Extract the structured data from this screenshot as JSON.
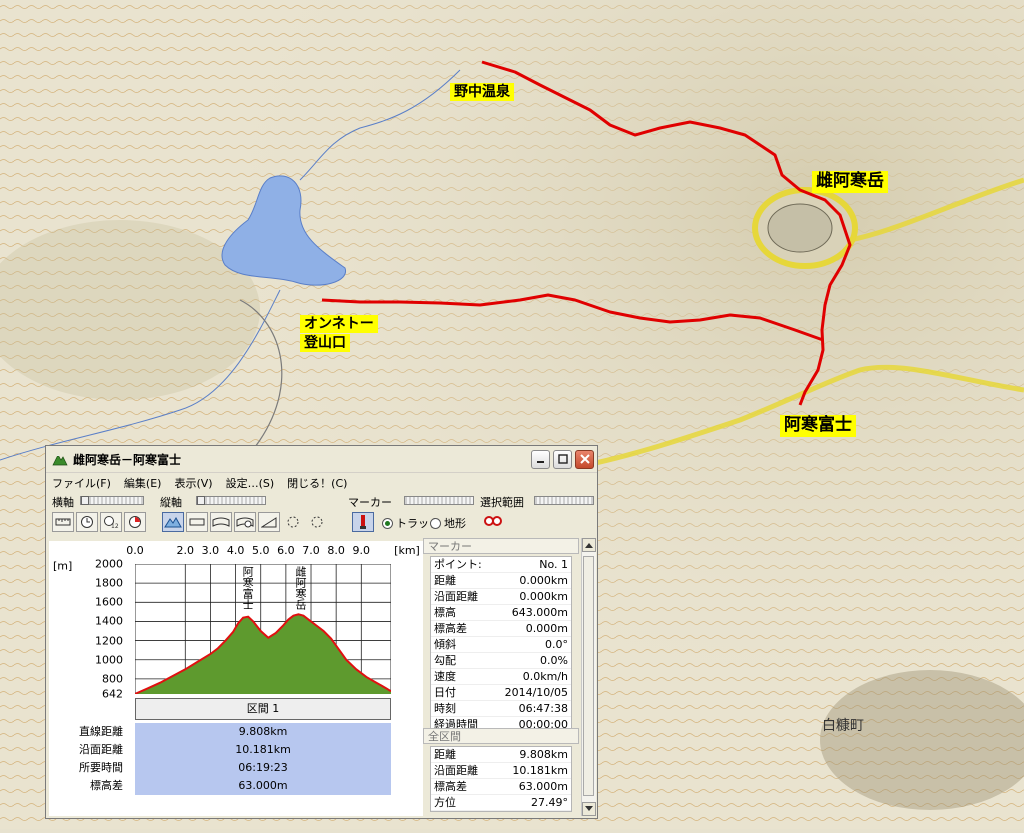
{
  "map": {
    "labels": [
      {
        "id": "nonaka",
        "text": "野中温泉"
      },
      {
        "id": "meakan",
        "text": "雌阿寒岳"
      },
      {
        "id": "onneto1",
        "text": "オンネトー"
      },
      {
        "id": "onneto2",
        "text": "登山口"
      },
      {
        "id": "fuji",
        "text": "阿寒富士"
      }
    ],
    "town_label": "白糠町",
    "colors": {
      "track": "#e00000",
      "label_bg": "#ffff00",
      "boundary": "#e6d73a",
      "lake": "#8fb0e6"
    }
  },
  "window": {
    "title": "雌阿寒岳－阿寒富士",
    "menu": [
      "ファイル(F)",
      "編集(E)",
      "表示(V)",
      "設定…(S)",
      "閉じる！(C)"
    ],
    "toolbar": {
      "horizontal_axis": "横軸",
      "vertical_axis": "縦軸",
      "marker": "マーカー",
      "selection_range": "選択範囲",
      "radio_track": "トラック",
      "radio_terrain": "地形",
      "selected_radio": "トラック"
    }
  },
  "chart_data": {
    "type": "area",
    "x_unit": "[km]",
    "y_unit": "[m]",
    "x_ticks": [
      "0.0",
      "2.0",
      "3.0",
      "4.0",
      "5.0",
      "6.0",
      "7.0",
      "8.0",
      "9.0"
    ],
    "y_ticks": [
      "2000",
      "1800",
      "1600",
      "1400",
      "1200",
      "1000",
      "800",
      "642"
    ],
    "xlim": [
      0,
      10.181
    ],
    "ylim": [
      642,
      2000
    ],
    "x": [
      0.0,
      0.5,
      1.0,
      1.5,
      2.0,
      2.5,
      3.0,
      3.3,
      3.6,
      3.9,
      4.1,
      4.3,
      4.5,
      4.7,
      5.0,
      5.3,
      5.6,
      5.9,
      6.1,
      6.3,
      6.5,
      6.7,
      6.9,
      7.2,
      7.5,
      7.8,
      8.1,
      8.4,
      8.8,
      9.2,
      9.6,
      10.0,
      10.181
    ],
    "y": [
      643,
      700,
      760,
      830,
      900,
      980,
      1060,
      1120,
      1200,
      1290,
      1380,
      1440,
      1450,
      1400,
      1300,
      1230,
      1280,
      1360,
      1420,
      1460,
      1475,
      1460,
      1420,
      1360,
      1300,
      1220,
      1110,
      1000,
      900,
      820,
      760,
      700,
      670
    ],
    "peak_labels": [
      {
        "text": "阿寒富士",
        "x": 4.4
      },
      {
        "text": "雌阿寒岳",
        "x": 6.5
      }
    ],
    "fill_color": "#5e9a2e",
    "line_color": "#e01010"
  },
  "section": {
    "label": "区間 1",
    "stats": [
      {
        "label": "直線距離",
        "value": "9.808km"
      },
      {
        "label": "沿面距離",
        "value": "10.181km"
      },
      {
        "label": "所要時間",
        "value": "06:19:23"
      },
      {
        "label": "標高差",
        "value": "63.000m"
      }
    ]
  },
  "marker_panel": {
    "title": "マーカー",
    "rows": [
      {
        "k": "ポイント:",
        "v": "No. 1"
      },
      {
        "k": "距離",
        "v": "0.000km"
      },
      {
        "k": "沿面距離",
        "v": "0.000km"
      },
      {
        "k": "標高",
        "v": "643.000m"
      },
      {
        "k": "標高差",
        "v": "0.000m"
      },
      {
        "k": "傾斜",
        "v": "0.0°"
      },
      {
        "k": "勾配",
        "v": "0.0%"
      },
      {
        "k": "速度",
        "v": "0.0km/h"
      },
      {
        "k": "日付",
        "v": "2014/10/05"
      },
      {
        "k": "時刻",
        "v": "06:47:38"
      },
      {
        "k": "経過時間",
        "v": "00:00:00"
      }
    ]
  },
  "total_panel": {
    "title": "全区間",
    "rows": [
      {
        "k": "距離",
        "v": "9.808km"
      },
      {
        "k": "沿面距離",
        "v": "10.181km"
      },
      {
        "k": "標高差",
        "v": "63.000m"
      },
      {
        "k": "方位",
        "v": "27.49°"
      }
    ]
  }
}
